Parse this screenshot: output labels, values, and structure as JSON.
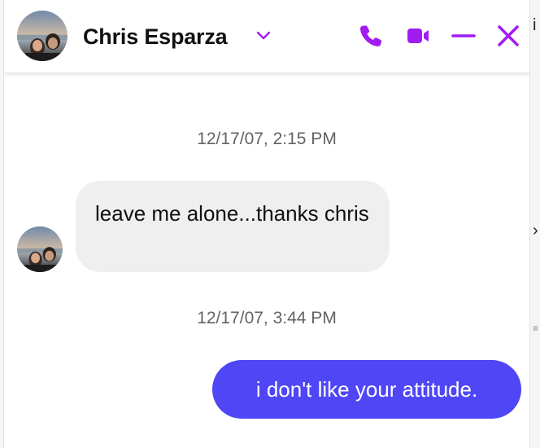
{
  "header": {
    "contact_name": "Chris Esparza",
    "dropdown_icon": "chevron-down-icon",
    "actions": [
      {
        "id": "call",
        "icon": "phone-icon"
      },
      {
        "id": "video",
        "icon": "video-camera-icon"
      },
      {
        "id": "minimize",
        "icon": "minus-icon"
      },
      {
        "id": "close",
        "icon": "close-icon"
      }
    ]
  },
  "messages": [
    {
      "timestamp": "12/17/07, 2:15 PM",
      "direction": "incoming",
      "text": "leave me alone...thanks chris"
    },
    {
      "timestamp": "12/17/07, 3:44 PM",
      "direction": "outgoing",
      "text": "i don't like your attitude."
    }
  ],
  "colors": {
    "accent": "#a21cf2",
    "outgoing_bubble": "#4f46f5",
    "incoming_bubble": "#efefef",
    "timestamp_text": "#636363"
  }
}
